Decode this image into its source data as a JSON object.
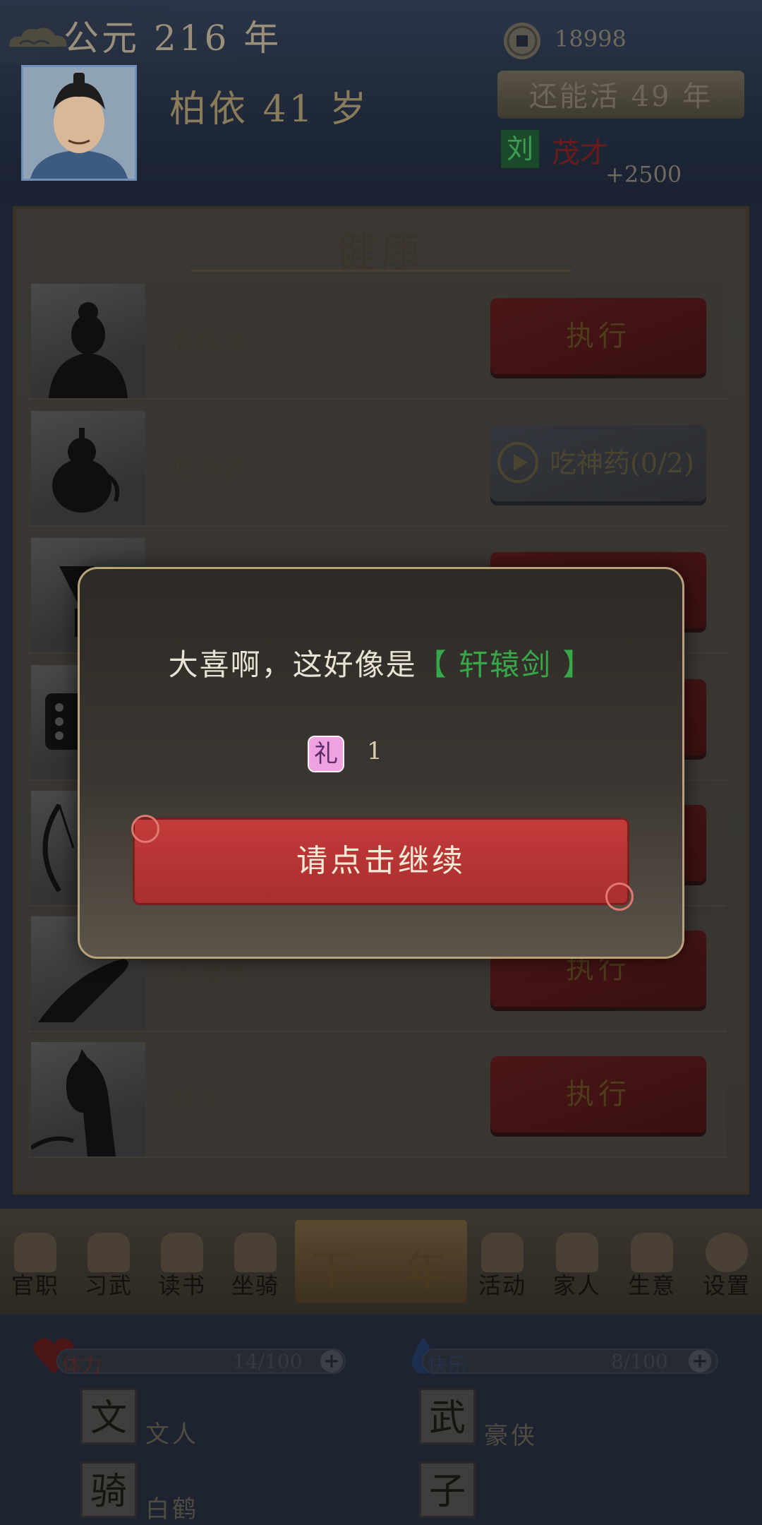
{
  "header": {
    "year": "公元 216 年",
    "character": "柏依 41 岁",
    "coins": "18998",
    "remaining_life": "还能活 49 年",
    "surname_badge": "刘",
    "talent": "茂才",
    "bonus": "+2500"
  },
  "panel": {
    "title": "健康",
    "rows": [
      {
        "icon": "doctor-silhouette-icon",
        "label": "看医生",
        "button": "执行"
      },
      {
        "icon": "gourd-icon",
        "label": "吃神药",
        "button": "吃神药(0/2)"
      },
      {
        "icon": "goblet-icon",
        "label": "",
        "button": ""
      },
      {
        "icon": "dice-icon",
        "label": "",
        "button": ""
      },
      {
        "icon": "bow-icon",
        "label": "",
        "button": ""
      },
      {
        "icon": "hand-icon",
        "label": "买宝物",
        "button": "执行"
      },
      {
        "icon": "horse-icon",
        "label": "打工",
        "button": "执行"
      }
    ]
  },
  "nav": {
    "items": [
      "官职",
      "习武",
      "读书",
      "坐骑",
      "活动",
      "家人",
      "生意",
      "设置"
    ],
    "next_year": "下一年"
  },
  "stats": {
    "health_label": "体力",
    "health_value": "14/100",
    "energy_label": "快乐",
    "energy_value": "8/100",
    "tags": [
      {
        "char": "文",
        "text": "文人"
      },
      {
        "char": "武",
        "text": "豪侠"
      },
      {
        "char": "骑",
        "text": "白鹤"
      },
      {
        "char": "子",
        "text": ""
      }
    ]
  },
  "modal": {
    "message_prefix": "大喜啊，这好像是",
    "item_name": "【 轩辕剑 】",
    "gift_icon": "礼",
    "gift_count": "1",
    "continue_label": "请点击继续"
  },
  "colors": {
    "modal_item": "#36a84a",
    "continue_button": "#c33b3b",
    "gift_icon_bg": "#f0a2e0"
  }
}
